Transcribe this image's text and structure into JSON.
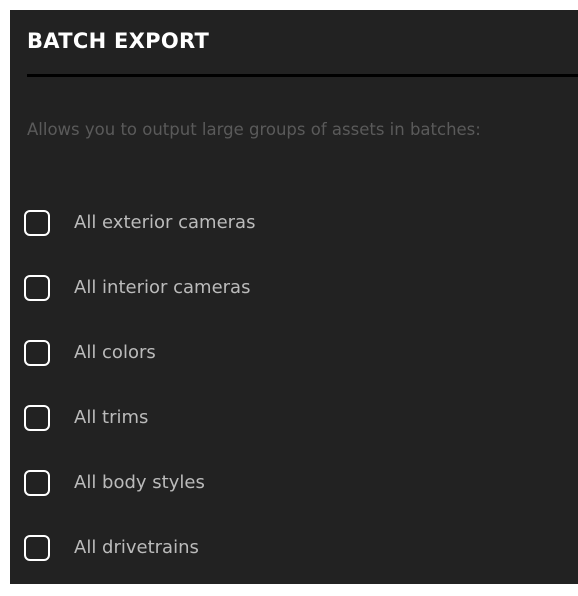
{
  "panel": {
    "title": "BATCH EXPORT",
    "description": "Allows you to output large groups of assets in batches:",
    "options": [
      {
        "label": "All exterior cameras",
        "checked": false
      },
      {
        "label": "All interior cameras",
        "checked": false
      },
      {
        "label": "All colors",
        "checked": false
      },
      {
        "label": "All trims",
        "checked": false
      },
      {
        "label": "All body styles",
        "checked": false
      },
      {
        "label": "All drivetrains",
        "checked": false
      }
    ]
  },
  "colors": {
    "panel_background": "#222222",
    "title": "#ffffff",
    "description": "#5a5a5a",
    "option_label": "#bbbbbb",
    "checkbox_border": "#ffffff",
    "divider": "#000000"
  }
}
